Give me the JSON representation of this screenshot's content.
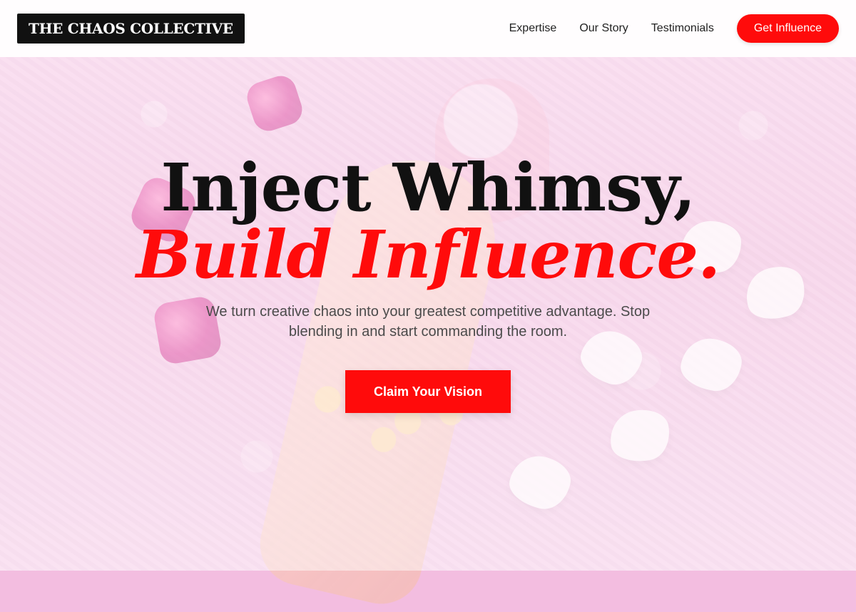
{
  "brand": {
    "name": "THE CHAOS COLLECTIVE"
  },
  "nav": {
    "items": [
      {
        "label": "Expertise"
      },
      {
        "label": "Our Story"
      },
      {
        "label": "Testimonials"
      }
    ],
    "cta_label": "Get Influence"
  },
  "hero": {
    "title_line1": "Inject Whimsy,",
    "title_line2": "Build Influence.",
    "subtitle": "We turn creative chaos into your greatest competitive advantage. Stop blending in and start commanding the room.",
    "cta_label": "Claim Your Vision"
  },
  "colors": {
    "accent": "#ff0b0b",
    "logo_bg": "#111111",
    "hero_bg": "#f3bde0"
  }
}
